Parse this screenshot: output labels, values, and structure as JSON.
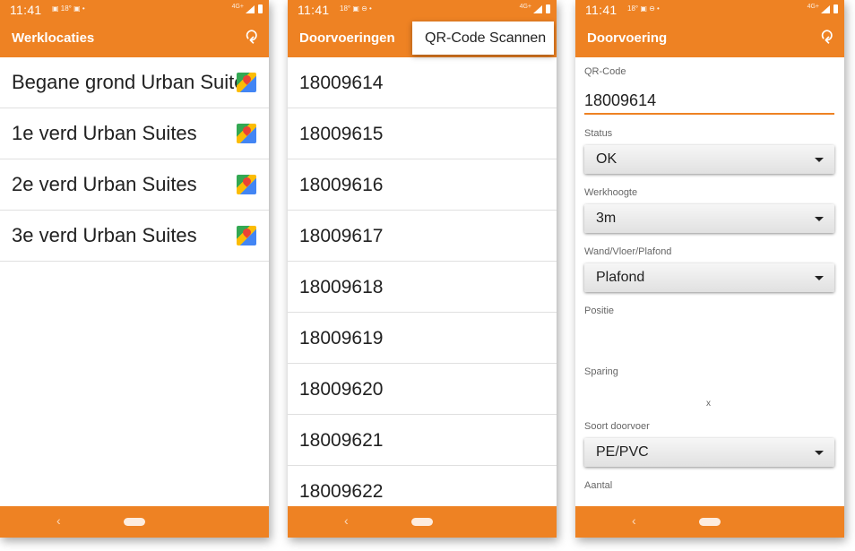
{
  "status_bar": {
    "time": "11:41",
    "screen1_icons": "▣ 18° ▣ •",
    "screen2_icons": "18° ▣ ⊖ •",
    "screen3_icons": "18° ▣ ⊖ •",
    "network": "4G+"
  },
  "screen1": {
    "title": "Werklocaties",
    "items": [
      {
        "label": "Begane grond Urban Suites"
      },
      {
        "label": "1e verd Urban Suites"
      },
      {
        "label": "2e verd Urban Suites"
      },
      {
        "label": "3e verd Urban Suites"
      }
    ]
  },
  "screen2": {
    "title": "Doorvoeringen",
    "menu_popup": "QR-Code Scannen",
    "items": [
      {
        "label": "18009614"
      },
      {
        "label": "18009615"
      },
      {
        "label": "18009616"
      },
      {
        "label": "18009617"
      },
      {
        "label": "18009618"
      },
      {
        "label": "18009619"
      },
      {
        "label": "18009620"
      },
      {
        "label": "18009621"
      },
      {
        "label": "18009622"
      }
    ]
  },
  "screen3": {
    "title": "Doorvoering",
    "qr_label": "QR-Code",
    "qr_value": "18009614",
    "status_label": "Status",
    "status_value": "OK",
    "werkhoogte_label": "Werkhoogte",
    "werkhoogte_value": "3m",
    "wand_label": "Wand/Vloer/Plafond",
    "wand_value": "Plafond",
    "positie_label": "Positie",
    "sparing_label": "Sparing",
    "sparing_separator": "x",
    "soort_label": "Soort doorvoer",
    "soort_value": "PE/PVC",
    "aantal_label": "Aantal"
  },
  "nav": {
    "back_glyph": "‹"
  },
  "colors": {
    "accent": "#ee8223",
    "divider": "#e0e0e0"
  }
}
